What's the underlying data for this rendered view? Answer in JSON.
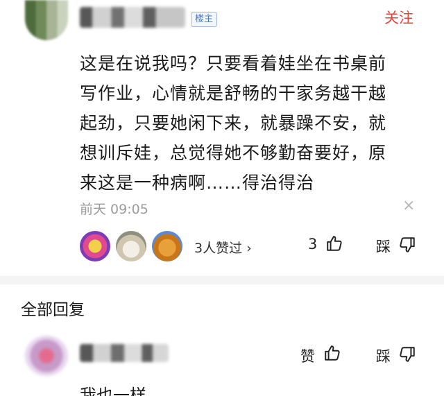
{
  "post": {
    "owner_badge": "楼主",
    "follow_label": "关注",
    "content_lines": [
      "这是在说我吗？只要看着娃坐在书桌前",
      "写作业，心情就是舒畅的干家务越干越",
      "起劲，只要她闲下来，就暴躁不安，就",
      "想训斥娃，总觉得她不够勤奋要好，原",
      "来这是一种病啊……得治得治"
    ],
    "time": "前天  09:05",
    "close_glyph": "×",
    "likers_text": "3人赞过 ›",
    "like_count": "3",
    "dislike_label": "踩"
  },
  "replies": {
    "section_title": "全部回复",
    "items": [
      {
        "like_label": "赞",
        "dislike_label": "踩",
        "text": "我也一样"
      }
    ]
  },
  "colors": {
    "follow": "#e0473c",
    "badge": "#4a7bd0",
    "meta": "#9a9a9a"
  },
  "icons": [
    "thumbs-up-icon",
    "thumbs-down-icon",
    "close-icon"
  ]
}
